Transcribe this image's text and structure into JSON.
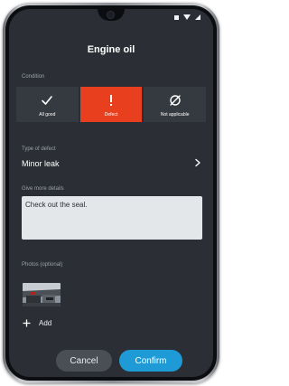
{
  "header": {
    "title": "Engine oil"
  },
  "condition": {
    "label": "Condition",
    "options": [
      {
        "label": "All good",
        "icon": "check-icon",
        "selected": false
      },
      {
        "label": "Defect",
        "icon": "exclamation-icon",
        "selected": true
      },
      {
        "label": "Not applicable",
        "icon": "not-applicable-icon",
        "selected": false
      }
    ],
    "selected_color": "#e8401f"
  },
  "defect_type": {
    "label": "Type of defect",
    "value": "Minor leak",
    "icon": "chevron-right-icon"
  },
  "details": {
    "label": "Give more details",
    "value": "Check out the seal."
  },
  "photos": {
    "label": "Photos (optional)",
    "thumbnail_icon": "engine-photo-thumbnail",
    "add_label": "Add",
    "add_icon": "plus-icon"
  },
  "actions": {
    "cancel_label": "Cancel",
    "confirm_label": "Confirm",
    "confirm_color": "#1e9bd6"
  },
  "colors": {
    "screen_bg": "#2b2f35",
    "tile_bg": "#353a41"
  }
}
